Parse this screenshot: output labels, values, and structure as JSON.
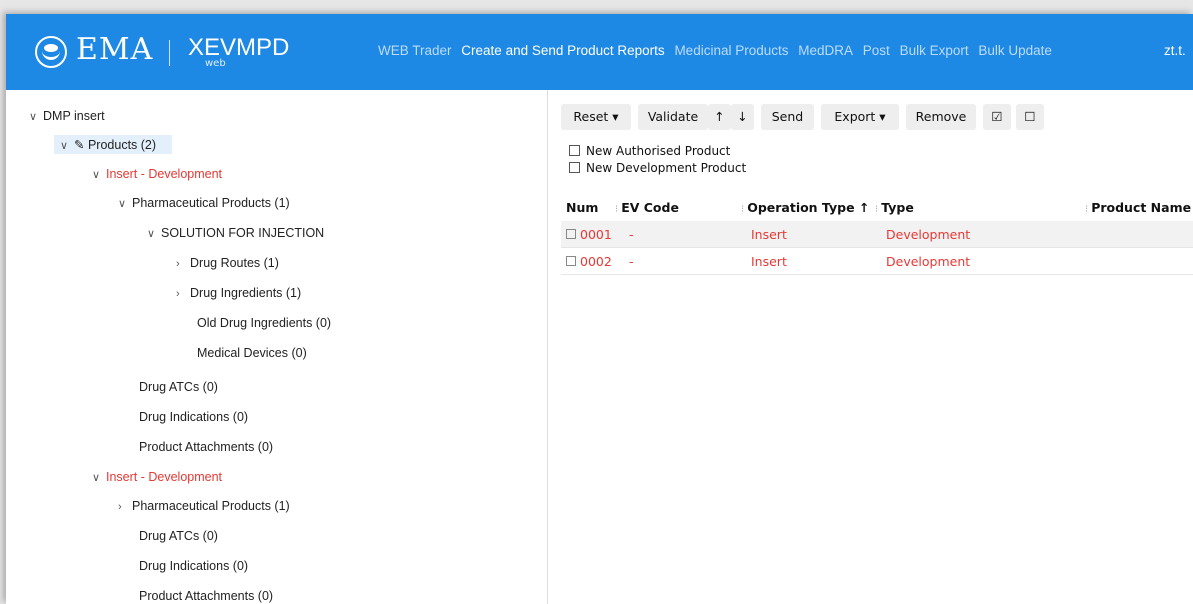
{
  "header": {
    "logo_text": "EMA",
    "product": "XEVMPD",
    "product_sub": "web",
    "nav": [
      "WEB Trader",
      "Create and Send Product Reports",
      "Medicinal Products",
      "MedDRA",
      "Post",
      "Bulk Export",
      "Bulk Update"
    ],
    "active_nav": "Create and Send Product Reports",
    "user": "zt.t."
  },
  "tree": {
    "root": "DMP insert",
    "products": "Products (2)",
    "insert1": "Insert - Development",
    "pharma1": "Pharmaceutical Products (1)",
    "solution": "SOLUTION FOR INJECTION",
    "routes": "Drug Routes (1)",
    "ingredients": "Drug Ingredients (1)",
    "old_ingredients": "Old Drug Ingredients (0)",
    "devices": "Medical Devices (0)",
    "atcs1": "Drug ATCs (0)",
    "indications1": "Drug Indications (0)",
    "attachments1": "Product Attachments (0)",
    "insert2": "Insert - Development",
    "pharma2": "Pharmaceutical Products (1)",
    "atcs2": "Drug ATCs (0)",
    "indications2": "Drug Indications (0)",
    "attachments2": "Product Attachments (0)"
  },
  "toolbar": {
    "reset": "Reset ▾",
    "validate": "Validate",
    "up": "↑",
    "down": "↓",
    "send": "Send",
    "export": "Export ▾",
    "remove": "Remove",
    "check_all": "☑",
    "uncheck_all": "☐"
  },
  "options": {
    "new_authorised": "New Authorised Product",
    "new_development": "New Development Product"
  },
  "table": {
    "headers": {
      "num": "Num",
      "ev_code": "EV Code",
      "operation": "Operation Type ↑",
      "type": "Type",
      "product_name": "Product Name"
    },
    "rows": [
      {
        "num": "0001",
        "ev_code": "-",
        "operation": "Insert",
        "type": "Development",
        "product_name": ""
      },
      {
        "num": "0002",
        "ev_code": "-",
        "operation": "Insert",
        "type": "Development",
        "product_name": ""
      }
    ]
  },
  "colors": {
    "header_bg": "#1e88e5",
    "accent_red": "#e53935",
    "selected_bg": "#e3f0fb"
  }
}
